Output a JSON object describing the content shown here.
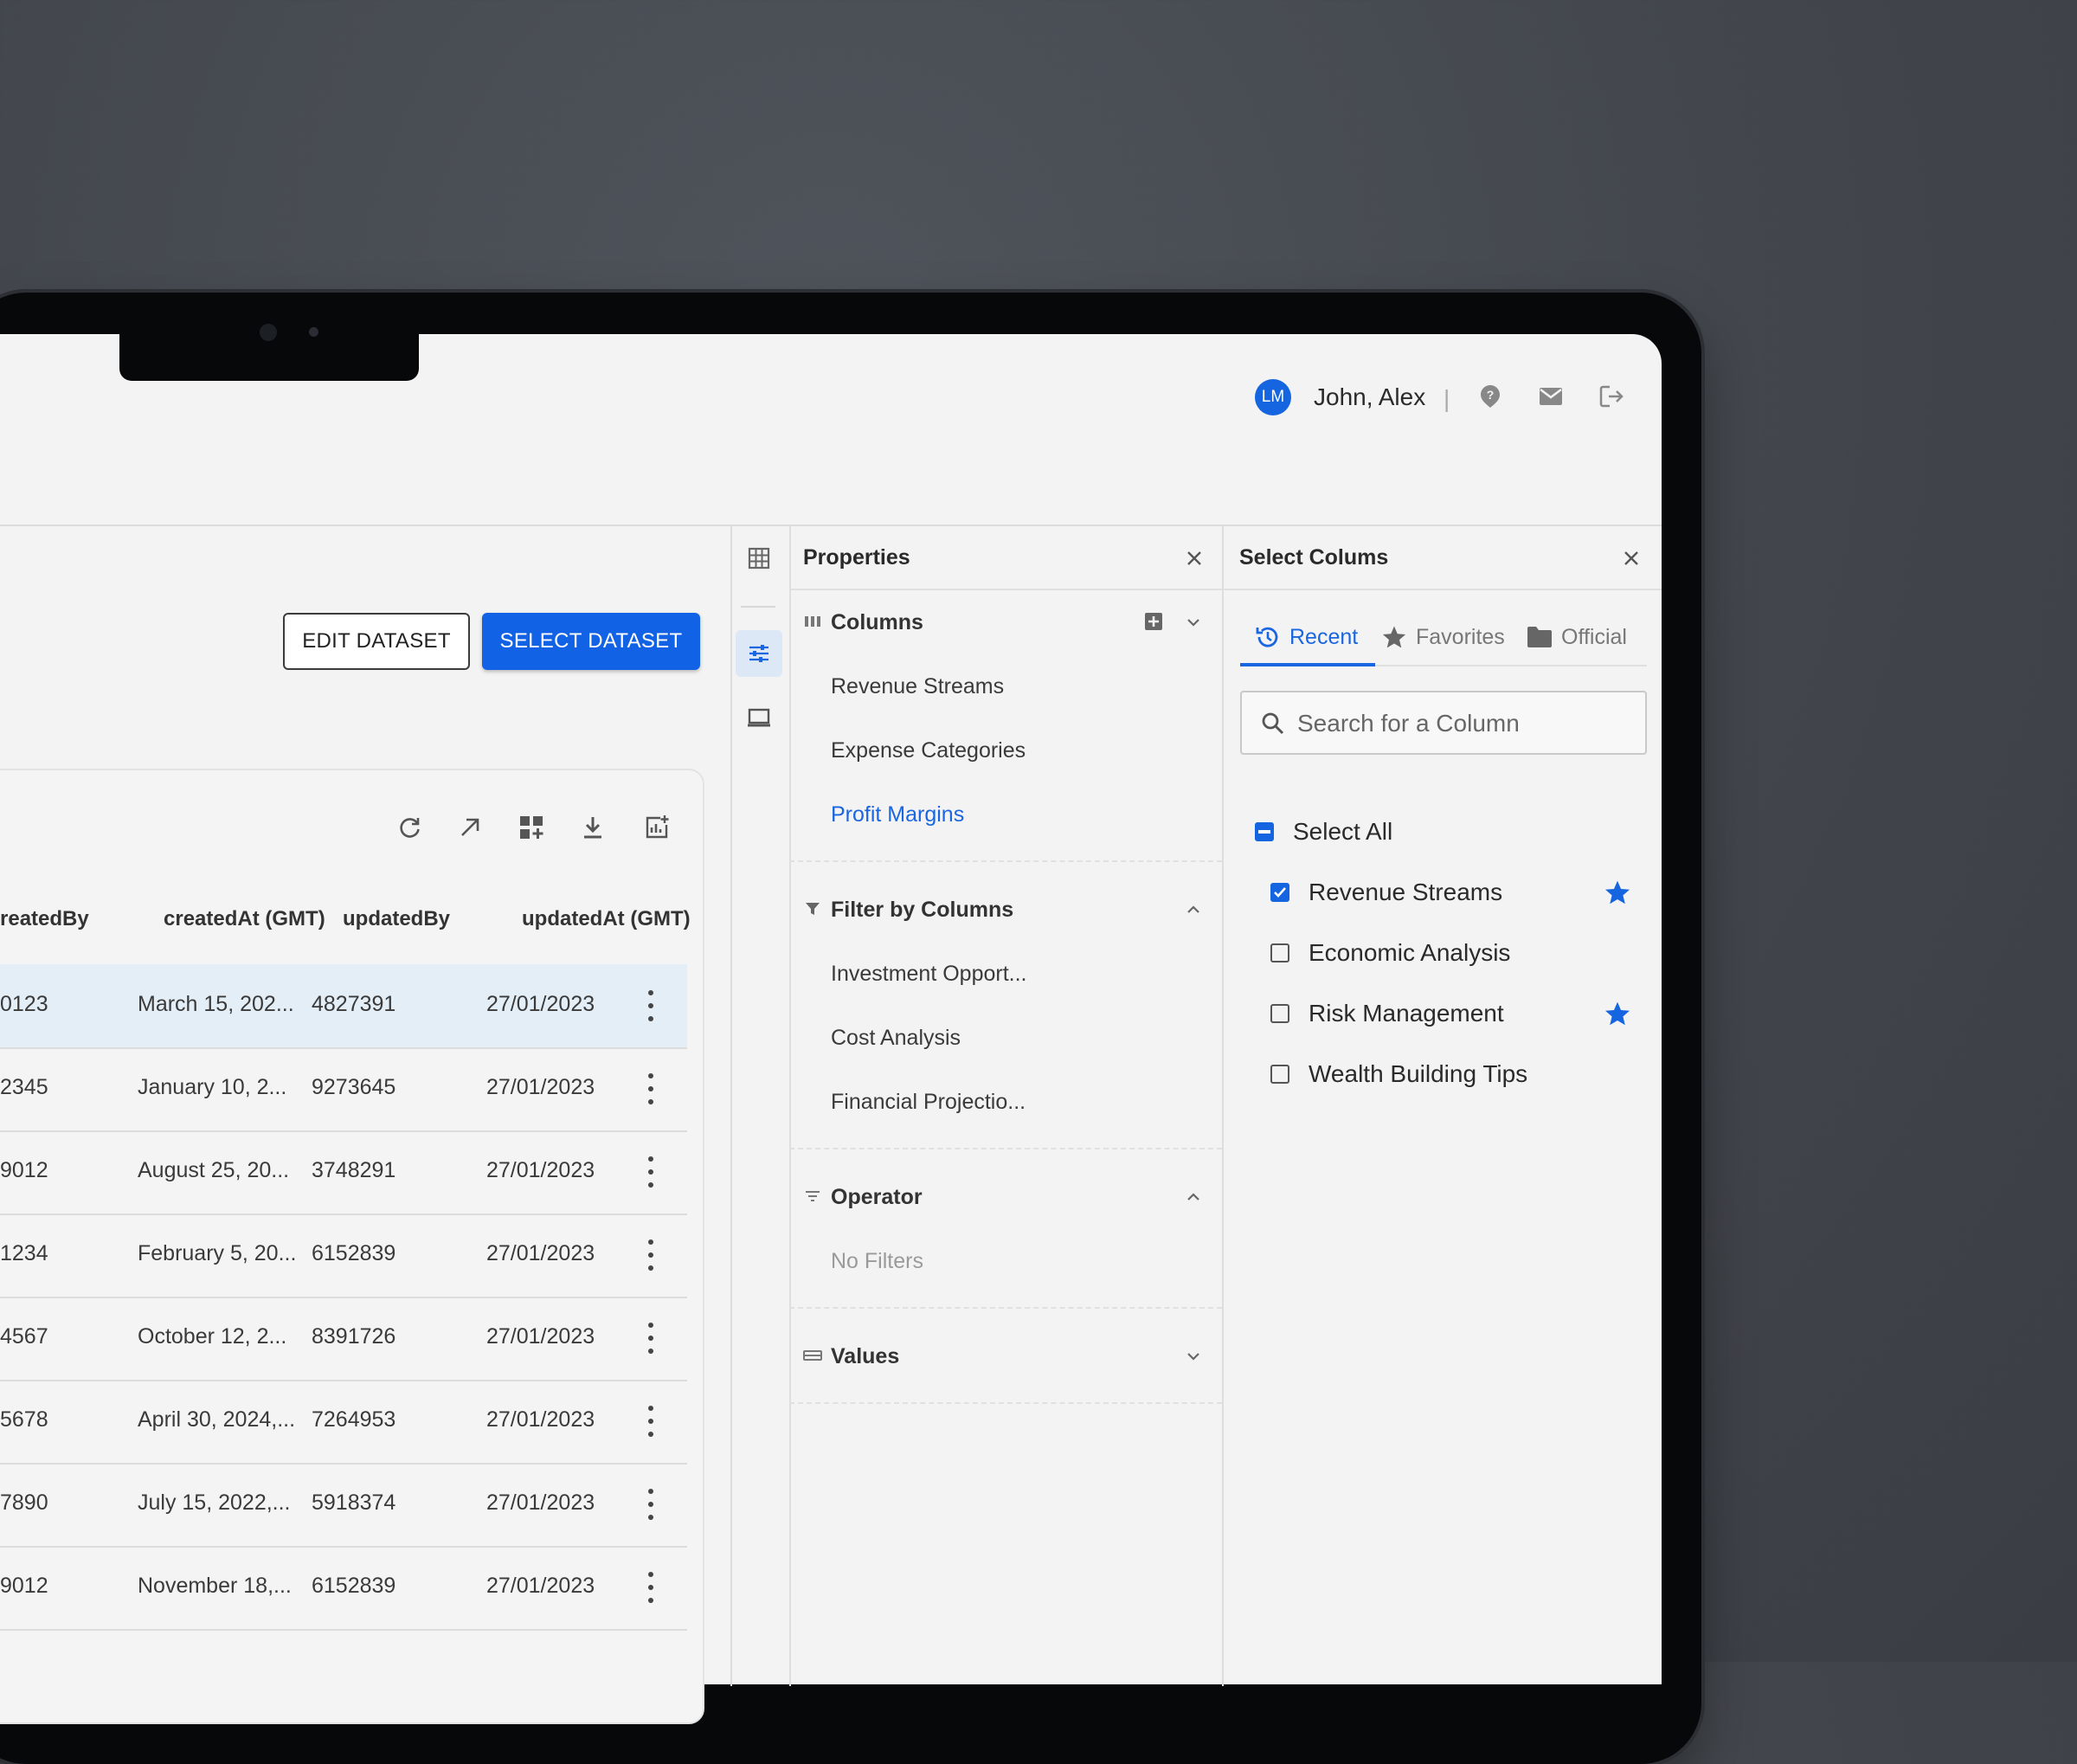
{
  "header": {
    "avatar_initials": "LM",
    "user_name": "John, Alex",
    "separator": "|",
    "icons": [
      "help-icon",
      "mail-icon",
      "logout-icon"
    ]
  },
  "toolbar": {
    "edit_label": "EDIT DATASET",
    "select_label": "SELECT DATASET",
    "table_icons": [
      "refresh-icon",
      "expand-icon",
      "add-widget-icon",
      "download-icon",
      "add-chart-icon"
    ]
  },
  "table": {
    "columns": [
      "reatedBy",
      "createdAt (GMT)",
      "updatedBy",
      "updatedAt (GMT)"
    ],
    "rows": [
      {
        "createdBy": "0123",
        "createdAt": "March 15, 202...",
        "updatedBy": "4827391",
        "updatedAt": "27/01/2023"
      },
      {
        "createdBy": "2345",
        "createdAt": "January 10, 2...",
        "updatedBy": "9273645",
        "updatedAt": "27/01/2023"
      },
      {
        "createdBy": "9012",
        "createdAt": "August 25, 20...",
        "updatedBy": "3748291",
        "updatedAt": "27/01/2023"
      },
      {
        "createdBy": "1234",
        "createdAt": "February 5, 20...",
        "updatedBy": "6152839",
        "updatedAt": "27/01/2023"
      },
      {
        "createdBy": "4567",
        "createdAt": "October 12, 2...",
        "updatedBy": "8391726",
        "updatedAt": "27/01/2023"
      },
      {
        "createdBy": "5678",
        "createdAt": "April 30, 2024,...",
        "updatedBy": "7264953",
        "updatedAt": "27/01/2023"
      },
      {
        "createdBy": "7890",
        "createdAt": "July 15, 2022,...",
        "updatedBy": "5918374",
        "updatedAt": "27/01/2023"
      },
      {
        "createdBy": "9012",
        "createdAt": "November 18,...",
        "updatedBy": "6152839",
        "updatedAt": "27/01/2023"
      }
    ]
  },
  "properties": {
    "title": "Properties",
    "columns_section": {
      "label": "Columns",
      "items": [
        "Revenue Streams",
        "Expense Categories",
        "Profit Margins"
      ],
      "active_item": "Profit Margins"
    },
    "filter_section": {
      "label": "Filter by Columns",
      "items": [
        "Investment Opport...",
        "Cost Analysis",
        "Financial Projectio..."
      ]
    },
    "operator_section": {
      "label": "Operator",
      "empty_text": "No Filters"
    },
    "values_section": {
      "label": "Values"
    }
  },
  "select_columns": {
    "title": "Select Colums",
    "tabs": [
      "Recent",
      "Favorites",
      "Official"
    ],
    "active_tab": "Recent",
    "search_placeholder": "Search for a Column",
    "select_all_label": "Select All",
    "select_all_state": "indeterminate",
    "items": [
      {
        "label": "Revenue Streams",
        "checked": true,
        "favorite": true
      },
      {
        "label": "Economic Analysis",
        "checked": false,
        "favorite": false
      },
      {
        "label": "Risk Management",
        "checked": false,
        "favorite": true
      },
      {
        "label": "Wealth Building Tips",
        "checked": false,
        "favorite": false
      }
    ]
  },
  "colors": {
    "accent": "#1565e0",
    "selected_row": "#e3eef7",
    "bezel": "#070809",
    "background": "#44484e"
  }
}
